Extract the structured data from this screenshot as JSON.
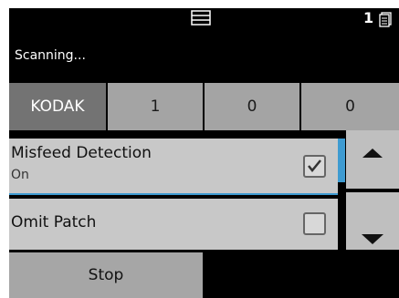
{
  "header": {
    "status": "Scanning...",
    "page_count": "1",
    "tray_icon": "tray-icon",
    "document_icon": "document-stack-icon"
  },
  "counters": {
    "brand": "KODAK",
    "values": [
      "1",
      "0",
      "0"
    ]
  },
  "settings": [
    {
      "title": "Misfeed Detection",
      "value": "On",
      "checked": true
    },
    {
      "title": "Omit Patch",
      "value": "",
      "checked": false
    }
  ],
  "scroll": {
    "up_icon": "chevron-up-icon",
    "down_icon": "chevron-down-icon"
  },
  "actions": {
    "stop_label": "Stop"
  },
  "colors": {
    "accent": "#3e9bd1",
    "background": "#000000",
    "panel": "#c8c8c8"
  }
}
